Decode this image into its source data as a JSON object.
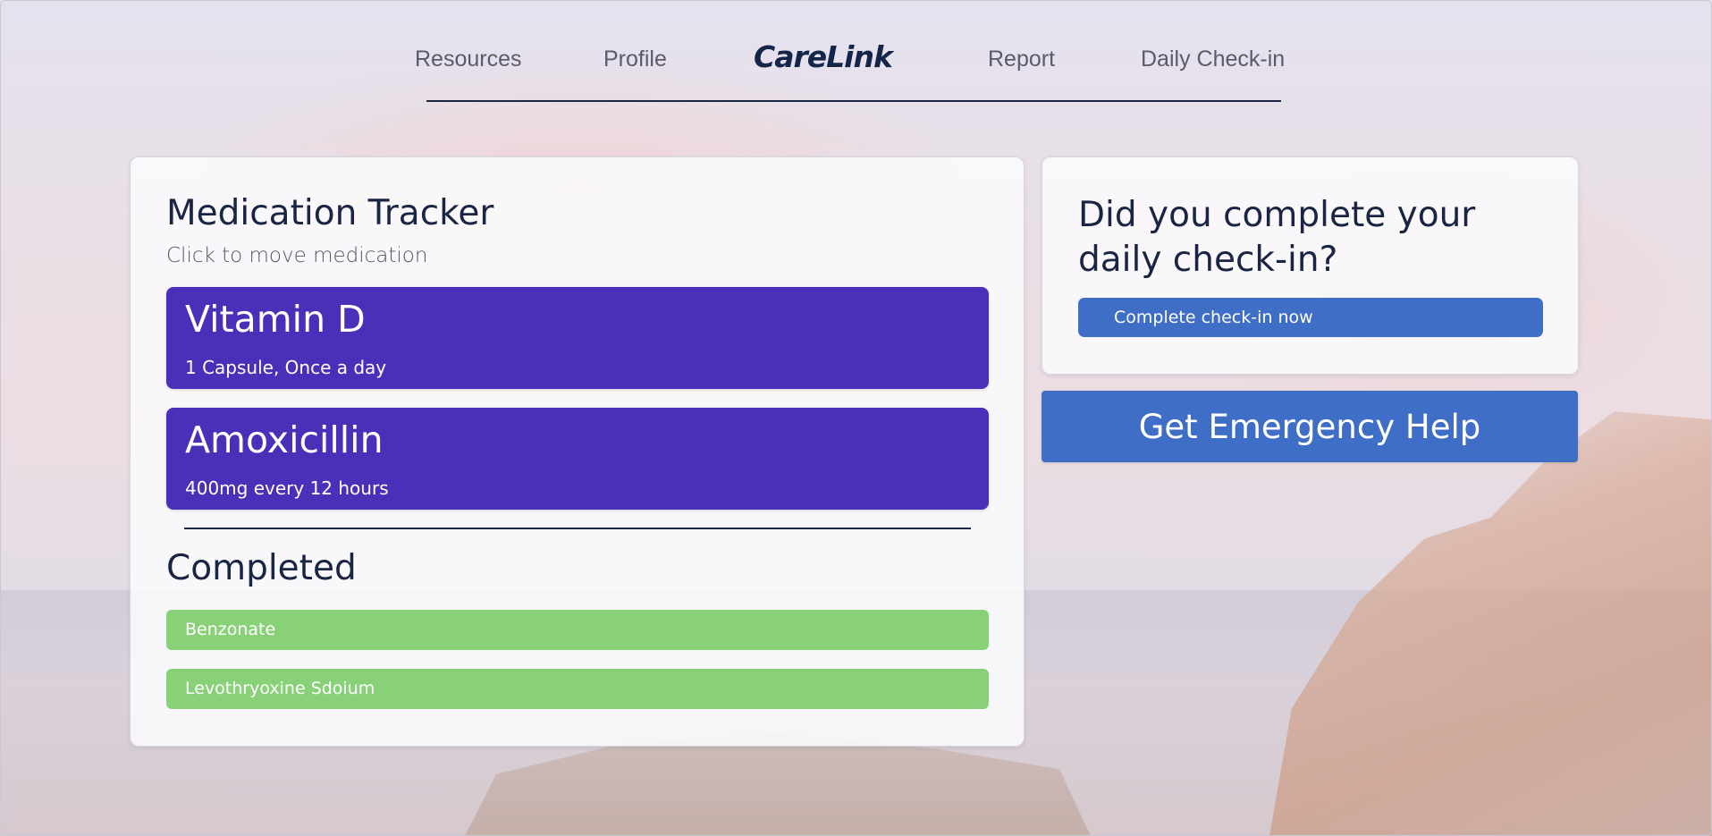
{
  "nav": {
    "links": [
      "Resources",
      "Profile",
      "Report",
      "Daily Check-in"
    ],
    "brand": "CareLink"
  },
  "tracker": {
    "title": "Medication Tracker",
    "subtitle": "Click to move medication",
    "pending": [
      {
        "name": "Vitamin D",
        "dose": "1 Capsule, Once a day"
      },
      {
        "name": "Amoxicillin",
        "dose": "400mg every 12 hours"
      }
    ],
    "completed_title": "Completed",
    "completed": [
      "Benzonate",
      "Levothryoxine Sdoium"
    ]
  },
  "checkin": {
    "question": "Did you complete your daily check-in?",
    "button_label": "Complete check-in now"
  },
  "emergency": {
    "button_label": "Get Emergency Help"
  },
  "colors": {
    "pending_item": "#4a30b9",
    "completed_item": "#89d178",
    "primary_button": "#3f6ec6",
    "heading_text": "#1a2544"
  }
}
